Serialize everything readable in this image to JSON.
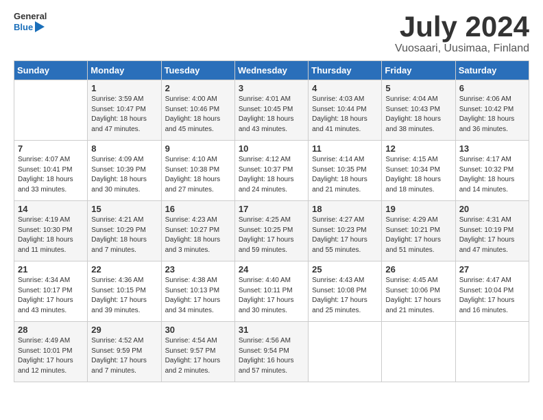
{
  "logo": {
    "line1": "General",
    "line2": "Blue"
  },
  "header": {
    "month": "July 2024",
    "location": "Vuosaari, Uusimaa, Finland"
  },
  "days_of_week": [
    "Sunday",
    "Monday",
    "Tuesday",
    "Wednesday",
    "Thursday",
    "Friday",
    "Saturday"
  ],
  "weeks": [
    [
      {
        "day": "",
        "info": ""
      },
      {
        "day": "1",
        "info": "Sunrise: 3:59 AM\nSunset: 10:47 PM\nDaylight: 18 hours\nand 47 minutes."
      },
      {
        "day": "2",
        "info": "Sunrise: 4:00 AM\nSunset: 10:46 PM\nDaylight: 18 hours\nand 45 minutes."
      },
      {
        "day": "3",
        "info": "Sunrise: 4:01 AM\nSunset: 10:45 PM\nDaylight: 18 hours\nand 43 minutes."
      },
      {
        "day": "4",
        "info": "Sunrise: 4:03 AM\nSunset: 10:44 PM\nDaylight: 18 hours\nand 41 minutes."
      },
      {
        "day": "5",
        "info": "Sunrise: 4:04 AM\nSunset: 10:43 PM\nDaylight: 18 hours\nand 38 minutes."
      },
      {
        "day": "6",
        "info": "Sunrise: 4:06 AM\nSunset: 10:42 PM\nDaylight: 18 hours\nand 36 minutes."
      }
    ],
    [
      {
        "day": "7",
        "info": "Sunrise: 4:07 AM\nSunset: 10:41 PM\nDaylight: 18 hours\nand 33 minutes."
      },
      {
        "day": "8",
        "info": "Sunrise: 4:09 AM\nSunset: 10:39 PM\nDaylight: 18 hours\nand 30 minutes."
      },
      {
        "day": "9",
        "info": "Sunrise: 4:10 AM\nSunset: 10:38 PM\nDaylight: 18 hours\nand 27 minutes."
      },
      {
        "day": "10",
        "info": "Sunrise: 4:12 AM\nSunset: 10:37 PM\nDaylight: 18 hours\nand 24 minutes."
      },
      {
        "day": "11",
        "info": "Sunrise: 4:14 AM\nSunset: 10:35 PM\nDaylight: 18 hours\nand 21 minutes."
      },
      {
        "day": "12",
        "info": "Sunrise: 4:15 AM\nSunset: 10:34 PM\nDaylight: 18 hours\nand 18 minutes."
      },
      {
        "day": "13",
        "info": "Sunrise: 4:17 AM\nSunset: 10:32 PM\nDaylight: 18 hours\nand 14 minutes."
      }
    ],
    [
      {
        "day": "14",
        "info": "Sunrise: 4:19 AM\nSunset: 10:30 PM\nDaylight: 18 hours\nand 11 minutes."
      },
      {
        "day": "15",
        "info": "Sunrise: 4:21 AM\nSunset: 10:29 PM\nDaylight: 18 hours\nand 7 minutes."
      },
      {
        "day": "16",
        "info": "Sunrise: 4:23 AM\nSunset: 10:27 PM\nDaylight: 18 hours\nand 3 minutes."
      },
      {
        "day": "17",
        "info": "Sunrise: 4:25 AM\nSunset: 10:25 PM\nDaylight: 17 hours\nand 59 minutes."
      },
      {
        "day": "18",
        "info": "Sunrise: 4:27 AM\nSunset: 10:23 PM\nDaylight: 17 hours\nand 55 minutes."
      },
      {
        "day": "19",
        "info": "Sunrise: 4:29 AM\nSunset: 10:21 PM\nDaylight: 17 hours\nand 51 minutes."
      },
      {
        "day": "20",
        "info": "Sunrise: 4:31 AM\nSunset: 10:19 PM\nDaylight: 17 hours\nand 47 minutes."
      }
    ],
    [
      {
        "day": "21",
        "info": "Sunrise: 4:34 AM\nSunset: 10:17 PM\nDaylight: 17 hours\nand 43 minutes."
      },
      {
        "day": "22",
        "info": "Sunrise: 4:36 AM\nSunset: 10:15 PM\nDaylight: 17 hours\nand 39 minutes."
      },
      {
        "day": "23",
        "info": "Sunrise: 4:38 AM\nSunset: 10:13 PM\nDaylight: 17 hours\nand 34 minutes."
      },
      {
        "day": "24",
        "info": "Sunrise: 4:40 AM\nSunset: 10:11 PM\nDaylight: 17 hours\nand 30 minutes."
      },
      {
        "day": "25",
        "info": "Sunrise: 4:43 AM\nSunset: 10:08 PM\nDaylight: 17 hours\nand 25 minutes."
      },
      {
        "day": "26",
        "info": "Sunrise: 4:45 AM\nSunset: 10:06 PM\nDaylight: 17 hours\nand 21 minutes."
      },
      {
        "day": "27",
        "info": "Sunrise: 4:47 AM\nSunset: 10:04 PM\nDaylight: 17 hours\nand 16 minutes."
      }
    ],
    [
      {
        "day": "28",
        "info": "Sunrise: 4:49 AM\nSunset: 10:01 PM\nDaylight: 17 hours\nand 12 minutes."
      },
      {
        "day": "29",
        "info": "Sunrise: 4:52 AM\nSunset: 9:59 PM\nDaylight: 17 hours\nand 7 minutes."
      },
      {
        "day": "30",
        "info": "Sunrise: 4:54 AM\nSunset: 9:57 PM\nDaylight: 17 hours\nand 2 minutes."
      },
      {
        "day": "31",
        "info": "Sunrise: 4:56 AM\nSunset: 9:54 PM\nDaylight: 16 hours\nand 57 minutes."
      },
      {
        "day": "",
        "info": ""
      },
      {
        "day": "",
        "info": ""
      },
      {
        "day": "",
        "info": ""
      }
    ]
  ]
}
